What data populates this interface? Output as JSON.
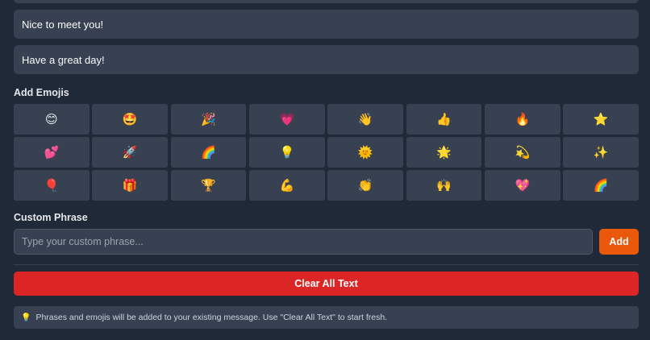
{
  "phrases": [
    "Nice to meet you!",
    "Have a great day!"
  ],
  "emoji_section": {
    "title": "Add Emojis",
    "emojis": [
      "😊",
      "🤩",
      "🎉",
      "💗",
      "👋",
      "👍",
      "🔥",
      "⭐",
      "💕",
      "🚀",
      "🌈",
      "💡",
      "🌞",
      "🌟",
      "💫",
      "✨",
      "🎈",
      "🎁",
      "🏆",
      "💪",
      "👏",
      "🙌",
      "💖",
      "🌈"
    ]
  },
  "custom_phrase": {
    "title": "Custom Phrase",
    "placeholder": "Type your custom phrase...",
    "add_label": "Add"
  },
  "clear_label": "Clear All Text",
  "hint": {
    "icon": "💡",
    "text": "Phrases and emojis will be added to your existing message. Use \"Clear All Text\" to start fresh."
  },
  "colors": {
    "background": "#1f2937",
    "panel": "#374151",
    "add_button": "#ea580c",
    "clear_button": "#dc2626"
  }
}
